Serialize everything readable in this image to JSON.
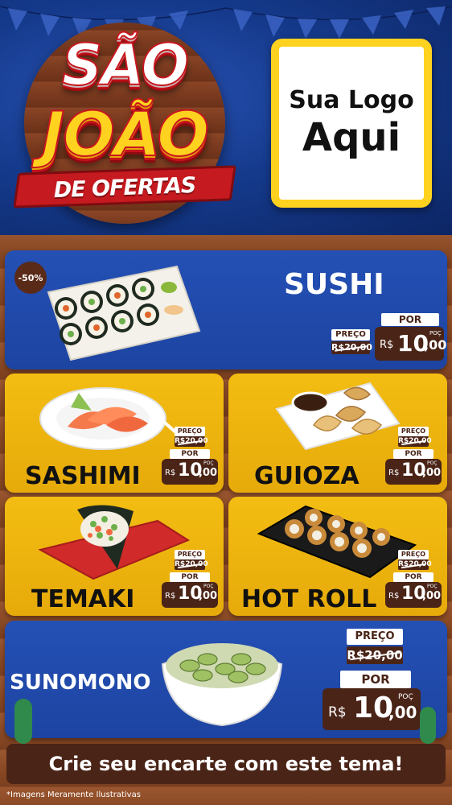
{
  "header": {
    "title_line1": "SÃO",
    "title_line2": "JOÃO",
    "ribbon": "DE OFERTAS",
    "logo_line1": "Sua Logo",
    "logo_line2": "Aqui"
  },
  "products": [
    {
      "name": "SUSHI",
      "badge": "-50%",
      "price_label": "PREÇO",
      "old_price": "R$20,00",
      "por_label": "POR",
      "currency": "R$",
      "price_int": "10",
      "price_dec": ",00",
      "poc": "POÇ"
    },
    {
      "name": "SASHIMI",
      "price_label": "PREÇO",
      "old_price": "R$20,00",
      "por_label": "POR",
      "currency": "R$",
      "price_int": "10",
      "price_dec": ",00",
      "poc": "POÇ"
    },
    {
      "name": "GUIOZA",
      "price_label": "PREÇO",
      "old_price": "R$20,00",
      "por_label": "POR",
      "currency": "R$",
      "price_int": "10",
      "price_dec": ",00",
      "poc": "POÇ"
    },
    {
      "name": "TEMAKI",
      "price_label": "PREÇO",
      "old_price": "R$20,00",
      "por_label": "POR",
      "currency": "R$",
      "price_int": "10",
      "price_dec": ",00",
      "poc": "POÇ"
    },
    {
      "name": "HOT ROLL",
      "price_label": "PREÇO",
      "old_price": "R$20,00",
      "por_label": "POR",
      "currency": "R$",
      "price_int": "10",
      "price_dec": ",00",
      "poc": "POÇ"
    },
    {
      "name": "SUNOMONO",
      "price_label": "PREÇO",
      "old_price": "R$20,00",
      "por_label": "POR",
      "currency": "R$",
      "price_int": "10",
      "price_dec": ",00",
      "poc": "POÇ"
    }
  ],
  "footer": {
    "cta": "Crie seu encarte com este tema!",
    "disclaimer": "*Imagens Meramente Ilustrativas"
  },
  "colors": {
    "blue_card": "#2450b5",
    "yellow_card": "#f3bd12",
    "tag_brown": "#4a2417",
    "title_red": "#c8171f",
    "title_yellow": "#ffd21f"
  }
}
